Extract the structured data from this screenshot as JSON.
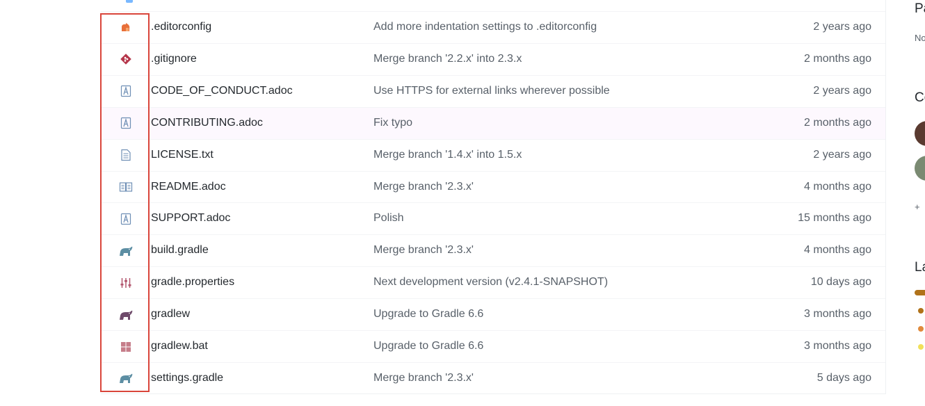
{
  "files": [
    {
      "icon": "editorconfig-icon",
      "name": ".editorconfig",
      "message": "Add more indentation settings to .editorconfig",
      "age": "2 years ago"
    },
    {
      "icon": "git-icon",
      "name": ".gitignore",
      "message": "Merge branch '2.2.x' into 2.3.x",
      "age": "2 months ago"
    },
    {
      "icon": "asciidoc-icon",
      "name": "CODE_OF_CONDUCT.adoc",
      "message": "Use HTTPS for external links wherever possible",
      "age": "2 years ago"
    },
    {
      "icon": "asciidoc-icon",
      "name": "CONTRIBUTING.adoc",
      "message": "Fix typo",
      "age": "2 months ago"
    },
    {
      "icon": "text-file-icon",
      "name": "LICENSE.txt",
      "message": "Merge branch '1.4.x' into 1.5.x",
      "age": "2 years ago"
    },
    {
      "icon": "readme-book-icon",
      "name": "README.adoc",
      "message": "Merge branch '2.3.x'",
      "age": "4 months ago"
    },
    {
      "icon": "asciidoc-icon",
      "name": "SUPPORT.adoc",
      "message": "Polish",
      "age": "15 months ago"
    },
    {
      "icon": "gradle-elephant-icon",
      "name": "build.gradle",
      "message": "Merge branch '2.3.x'",
      "age": "4 months ago"
    },
    {
      "icon": "properties-sliders-icon",
      "name": "gradle.properties",
      "message": "Next development version (v2.4.1-SNAPSHOT)",
      "age": "10 days ago"
    },
    {
      "icon": "gradle-elephant-icon",
      "name": "gradlew",
      "message": "Upgrade to Gradle 6.6",
      "age": "3 months ago"
    },
    {
      "icon": "windows-icon",
      "name": "gradlew.bat",
      "message": "Upgrade to Gradle 6.6",
      "age": "3 months ago"
    },
    {
      "icon": "gradle-elephant-icon",
      "name": "settings.gradle",
      "message": "Merge branch '2.3.x'",
      "age": "5 days ago"
    }
  ],
  "sidebar": {
    "packages_heading": "Pa",
    "packages_text": "No",
    "contributors_heading": "Co",
    "contributors_more": "+",
    "languages_heading": "La"
  },
  "colors": {
    "highlight_border": "#d9453b",
    "hover_row": "#fdf8fe",
    "java": "#b07219",
    "kotlin": "#e08a3c",
    "javascript": "#f1e05a"
  }
}
